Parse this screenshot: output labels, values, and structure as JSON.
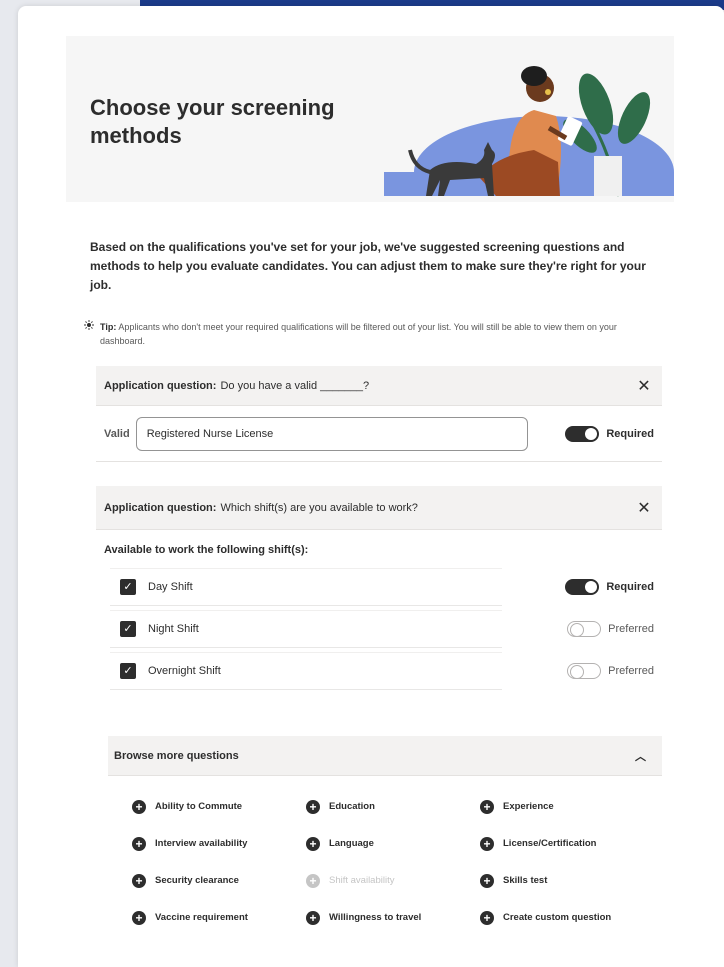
{
  "hero": {
    "title": "Choose your screening methods"
  },
  "intro": "Based on the qualifications you've set for your job, we've suggested screening questions and methods to help you evaluate candidates. You can adjust them to make sure they're right for your job.",
  "tip": {
    "label": "Tip:",
    "text": "Applicants who don't meet your required qualifications will be filtered out of your list. You will still be able to view them on your dashboard."
  },
  "question1": {
    "label": "Application question:",
    "text": "Do you have a valid _______?",
    "field_label": "Valid",
    "field_value": "Registered Nurse License",
    "toggle_label": "Required",
    "toggle_on": true
  },
  "question2": {
    "label": "Application question:",
    "text": "Which shift(s) are you available to work?",
    "subheading": "Available to work the following shift(s):",
    "shifts": [
      {
        "name": "Day Shift",
        "checked": true,
        "toggle_label": "Required",
        "toggle_on": true
      },
      {
        "name": "Night Shift",
        "checked": true,
        "toggle_label": "Preferred",
        "toggle_on": false
      },
      {
        "name": "Overnight Shift",
        "checked": true,
        "toggle_label": "Preferred",
        "toggle_on": false
      }
    ]
  },
  "browse": {
    "title": "Browse more questions",
    "items": [
      {
        "label": "Ability to Commute",
        "enabled": true
      },
      {
        "label": "Education",
        "enabled": true
      },
      {
        "label": "Experience",
        "enabled": true
      },
      {
        "label": "Interview availability",
        "enabled": true
      },
      {
        "label": "Language",
        "enabled": true
      },
      {
        "label": "License/Certification",
        "enabled": true
      },
      {
        "label": "Security clearance",
        "enabled": true
      },
      {
        "label": "Shift availability",
        "enabled": false
      },
      {
        "label": "Skills test",
        "enabled": true
      },
      {
        "label": "Vaccine requirement",
        "enabled": true
      },
      {
        "label": "Willingness to travel",
        "enabled": true
      },
      {
        "label": "Create custom question",
        "enabled": true
      }
    ]
  },
  "colors": {
    "accent_bar": "#1b3b8a",
    "illustration_blue": "#6f8ddb",
    "illustration_skin": "#e08a4f"
  }
}
